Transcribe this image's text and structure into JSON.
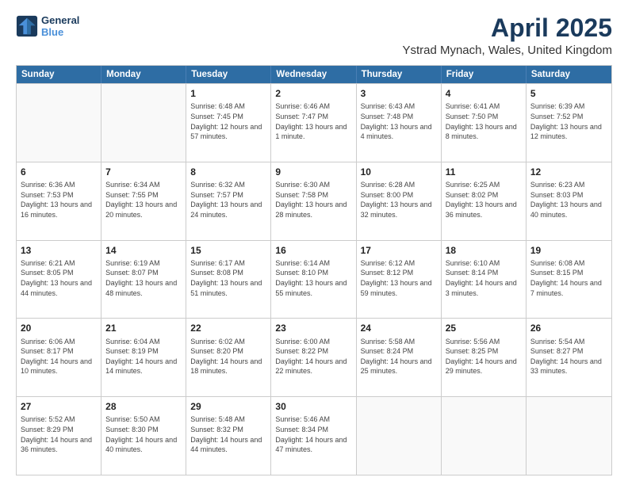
{
  "logo": {
    "line1": "General",
    "line2": "Blue"
  },
  "title": "April 2025",
  "subtitle": "Ystrad Mynach, Wales, United Kingdom",
  "header_days": [
    "Sunday",
    "Monday",
    "Tuesday",
    "Wednesday",
    "Thursday",
    "Friday",
    "Saturday"
  ],
  "weeks": [
    [
      {
        "day": "",
        "sunrise": "",
        "sunset": "",
        "daylight": ""
      },
      {
        "day": "",
        "sunrise": "",
        "sunset": "",
        "daylight": ""
      },
      {
        "day": "1",
        "sunrise": "Sunrise: 6:48 AM",
        "sunset": "Sunset: 7:45 PM",
        "daylight": "Daylight: 12 hours and 57 minutes."
      },
      {
        "day": "2",
        "sunrise": "Sunrise: 6:46 AM",
        "sunset": "Sunset: 7:47 PM",
        "daylight": "Daylight: 13 hours and 1 minute."
      },
      {
        "day": "3",
        "sunrise": "Sunrise: 6:43 AM",
        "sunset": "Sunset: 7:48 PM",
        "daylight": "Daylight: 13 hours and 4 minutes."
      },
      {
        "day": "4",
        "sunrise": "Sunrise: 6:41 AM",
        "sunset": "Sunset: 7:50 PM",
        "daylight": "Daylight: 13 hours and 8 minutes."
      },
      {
        "day": "5",
        "sunrise": "Sunrise: 6:39 AM",
        "sunset": "Sunset: 7:52 PM",
        "daylight": "Daylight: 13 hours and 12 minutes."
      }
    ],
    [
      {
        "day": "6",
        "sunrise": "Sunrise: 6:36 AM",
        "sunset": "Sunset: 7:53 PM",
        "daylight": "Daylight: 13 hours and 16 minutes."
      },
      {
        "day": "7",
        "sunrise": "Sunrise: 6:34 AM",
        "sunset": "Sunset: 7:55 PM",
        "daylight": "Daylight: 13 hours and 20 minutes."
      },
      {
        "day": "8",
        "sunrise": "Sunrise: 6:32 AM",
        "sunset": "Sunset: 7:57 PM",
        "daylight": "Daylight: 13 hours and 24 minutes."
      },
      {
        "day": "9",
        "sunrise": "Sunrise: 6:30 AM",
        "sunset": "Sunset: 7:58 PM",
        "daylight": "Daylight: 13 hours and 28 minutes."
      },
      {
        "day": "10",
        "sunrise": "Sunrise: 6:28 AM",
        "sunset": "Sunset: 8:00 PM",
        "daylight": "Daylight: 13 hours and 32 minutes."
      },
      {
        "day": "11",
        "sunrise": "Sunrise: 6:25 AM",
        "sunset": "Sunset: 8:02 PM",
        "daylight": "Daylight: 13 hours and 36 minutes."
      },
      {
        "day": "12",
        "sunrise": "Sunrise: 6:23 AM",
        "sunset": "Sunset: 8:03 PM",
        "daylight": "Daylight: 13 hours and 40 minutes."
      }
    ],
    [
      {
        "day": "13",
        "sunrise": "Sunrise: 6:21 AM",
        "sunset": "Sunset: 8:05 PM",
        "daylight": "Daylight: 13 hours and 44 minutes."
      },
      {
        "day": "14",
        "sunrise": "Sunrise: 6:19 AM",
        "sunset": "Sunset: 8:07 PM",
        "daylight": "Daylight: 13 hours and 48 minutes."
      },
      {
        "day": "15",
        "sunrise": "Sunrise: 6:17 AM",
        "sunset": "Sunset: 8:08 PM",
        "daylight": "Daylight: 13 hours and 51 minutes."
      },
      {
        "day": "16",
        "sunrise": "Sunrise: 6:14 AM",
        "sunset": "Sunset: 8:10 PM",
        "daylight": "Daylight: 13 hours and 55 minutes."
      },
      {
        "day": "17",
        "sunrise": "Sunrise: 6:12 AM",
        "sunset": "Sunset: 8:12 PM",
        "daylight": "Daylight: 13 hours and 59 minutes."
      },
      {
        "day": "18",
        "sunrise": "Sunrise: 6:10 AM",
        "sunset": "Sunset: 8:14 PM",
        "daylight": "Daylight: 14 hours and 3 minutes."
      },
      {
        "day": "19",
        "sunrise": "Sunrise: 6:08 AM",
        "sunset": "Sunset: 8:15 PM",
        "daylight": "Daylight: 14 hours and 7 minutes."
      }
    ],
    [
      {
        "day": "20",
        "sunrise": "Sunrise: 6:06 AM",
        "sunset": "Sunset: 8:17 PM",
        "daylight": "Daylight: 14 hours and 10 minutes."
      },
      {
        "day": "21",
        "sunrise": "Sunrise: 6:04 AM",
        "sunset": "Sunset: 8:19 PM",
        "daylight": "Daylight: 14 hours and 14 minutes."
      },
      {
        "day": "22",
        "sunrise": "Sunrise: 6:02 AM",
        "sunset": "Sunset: 8:20 PM",
        "daylight": "Daylight: 14 hours and 18 minutes."
      },
      {
        "day": "23",
        "sunrise": "Sunrise: 6:00 AM",
        "sunset": "Sunset: 8:22 PM",
        "daylight": "Daylight: 14 hours and 22 minutes."
      },
      {
        "day": "24",
        "sunrise": "Sunrise: 5:58 AM",
        "sunset": "Sunset: 8:24 PM",
        "daylight": "Daylight: 14 hours and 25 minutes."
      },
      {
        "day": "25",
        "sunrise": "Sunrise: 5:56 AM",
        "sunset": "Sunset: 8:25 PM",
        "daylight": "Daylight: 14 hours and 29 minutes."
      },
      {
        "day": "26",
        "sunrise": "Sunrise: 5:54 AM",
        "sunset": "Sunset: 8:27 PM",
        "daylight": "Daylight: 14 hours and 33 minutes."
      }
    ],
    [
      {
        "day": "27",
        "sunrise": "Sunrise: 5:52 AM",
        "sunset": "Sunset: 8:29 PM",
        "daylight": "Daylight: 14 hours and 36 minutes."
      },
      {
        "day": "28",
        "sunrise": "Sunrise: 5:50 AM",
        "sunset": "Sunset: 8:30 PM",
        "daylight": "Daylight: 14 hours and 40 minutes."
      },
      {
        "day": "29",
        "sunrise": "Sunrise: 5:48 AM",
        "sunset": "Sunset: 8:32 PM",
        "daylight": "Daylight: 14 hours and 44 minutes."
      },
      {
        "day": "30",
        "sunrise": "Sunrise: 5:46 AM",
        "sunset": "Sunset: 8:34 PM",
        "daylight": "Daylight: 14 hours and 47 minutes."
      },
      {
        "day": "",
        "sunrise": "",
        "sunset": "",
        "daylight": ""
      },
      {
        "day": "",
        "sunrise": "",
        "sunset": "",
        "daylight": ""
      },
      {
        "day": "",
        "sunrise": "",
        "sunset": "",
        "daylight": ""
      }
    ]
  ]
}
